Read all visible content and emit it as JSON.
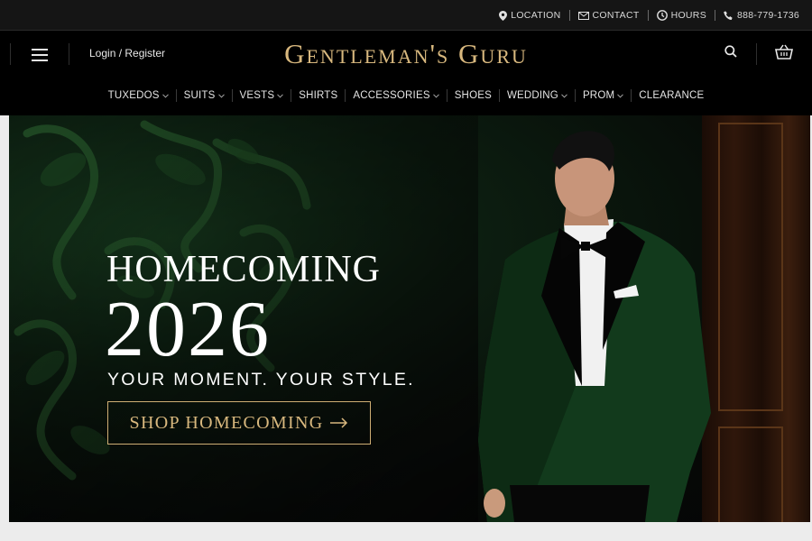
{
  "topbar": {
    "links": [
      {
        "label": "LOCATION",
        "icon": "location-pin-icon"
      },
      {
        "label": "CONTACT",
        "icon": "envelope-icon"
      },
      {
        "label": "HOURS",
        "icon": "clock-icon"
      },
      {
        "label": "888-779-1736",
        "icon": "phone-icon"
      }
    ]
  },
  "header": {
    "login_label": "Login / Register",
    "logo_text": "Gentleman's Guru",
    "menu_icon": "hamburger-menu-icon",
    "search_icon": "search-icon",
    "cart_icon": "cart-icon"
  },
  "nav": {
    "items": [
      {
        "label": "TUXEDOS",
        "dropdown": true
      },
      {
        "label": "SUITS",
        "dropdown": true
      },
      {
        "label": "VESTS",
        "dropdown": true
      },
      {
        "label": "SHIRTS",
        "dropdown": false
      },
      {
        "label": "ACCESSORIES",
        "dropdown": true
      },
      {
        "label": "SHOES",
        "dropdown": false
      },
      {
        "label": "WEDDING",
        "dropdown": true
      },
      {
        "label": "PROM",
        "dropdown": true
      },
      {
        "label": "CLEARANCE",
        "dropdown": false
      }
    ]
  },
  "hero": {
    "title": "HOMECOMING",
    "year": "2026",
    "tagline": "YOUR MOMENT. YOUR STYLE.",
    "cta_label": "SHOP HOMECOMING",
    "cta_icon": "arrow-right-icon"
  },
  "colors": {
    "gold_accent": "#d8b87e",
    "topbar_bg": "#151515",
    "header_bg": "#000000",
    "velvet_green": "#143a1c"
  }
}
